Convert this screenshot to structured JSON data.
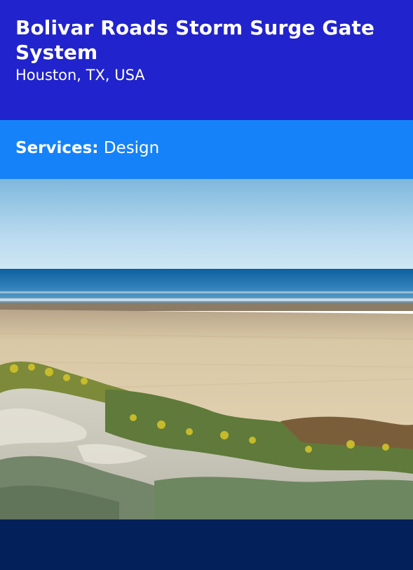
{
  "project": {
    "title": "Bolivar Roads Storm Surge Gate System",
    "location": "Houston, TX, USA"
  },
  "services": {
    "label": "Services:",
    "value": "Design"
  },
  "photo": {
    "subject": "beach-dunes-photo"
  },
  "colors": {
    "title_bg": "#2123cc",
    "services_bg": "#1582f9",
    "footer_bg": "#03205b"
  }
}
